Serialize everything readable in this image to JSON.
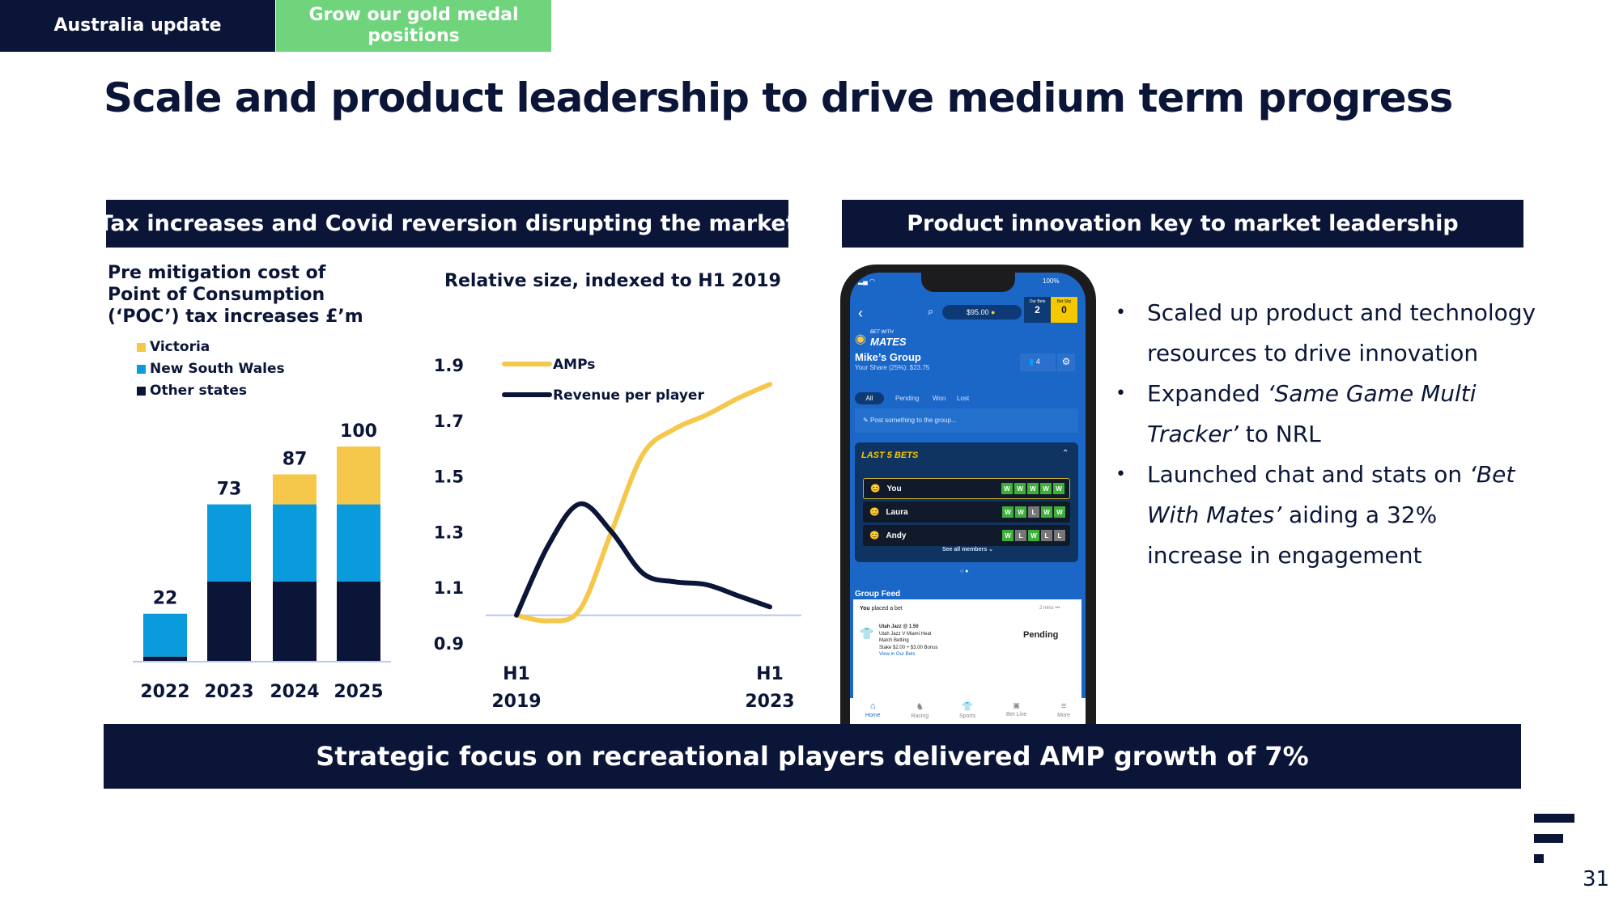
{
  "tags": {
    "section": "Australia update",
    "theme": "Grow our gold medal positions"
  },
  "title": "Scale and product leadership to drive medium term progress",
  "left_header": "Tax increases and Covid reversion disrupting the market",
  "right_header": "Product innovation key to market leadership",
  "banner": "Strategic focus on recreational players delivered AMP growth of 7%",
  "bullets": [
    {
      "pre": "Scaled up product and technology resources to drive innovation",
      "em": "",
      "post": ""
    },
    {
      "pre": "Expanded ",
      "em": "‘Same Game Multi Tracker’",
      "post": " to NRL"
    },
    {
      "pre": "Launched chat and stats on ",
      "em": "‘Bet With Mates’",
      "post": " aiding a 32% increase in engagement"
    }
  ],
  "page_number": "31",
  "colors": {
    "navy": "#0b1538",
    "green": "#6fd47c",
    "victoria": "#f5c84c",
    "nsw": "#0a9bdc",
    "other": "#0b1538",
    "baseline": "#b9c8ee"
  },
  "chart_data": [
    {
      "type": "bar",
      "stacked": true,
      "title": "Pre mitigation cost of Point of Consumption (‘POC’) tax increases £’m",
      "categories": [
        "2022",
        "2023",
        "2024",
        "2025"
      ],
      "series": [
        {
          "name": "Other states",
          "values": [
            2,
            37,
            37,
            37
          ],
          "color": "#0b1538"
        },
        {
          "name": "New South Wales",
          "values": [
            20,
            36,
            36,
            36
          ],
          "color": "#0a9bdc"
        },
        {
          "name": "Victoria",
          "values": [
            0,
            0,
            14,
            27
          ],
          "color": "#f5c84c"
        }
      ],
      "totals": [
        "22",
        "73",
        "87",
        "100"
      ],
      "legend_order": [
        "Victoria",
        "New South Wales",
        "Other states"
      ],
      "legend": "top-left",
      "ylim": [
        0,
        100
      ]
    },
    {
      "type": "line",
      "title": "Relative size, indexed to H1 2019",
      "x_tick_labels": [
        [
          "H1",
          "2019"
        ],
        [
          "H1",
          "2023"
        ]
      ],
      "x": [
        0,
        1,
        2,
        3,
        4,
        5,
        6,
        7,
        8
      ],
      "y_ticks": [
        "1.9",
        "1.7",
        "1.5",
        "1.3",
        "1.1",
        "0.9"
      ],
      "ylim": [
        0.9,
        1.9
      ],
      "reference_line": 1.0,
      "series": [
        {
          "name": "AMPs",
          "values": [
            1.0,
            0.98,
            1.02,
            1.3,
            1.58,
            1.67,
            1.72,
            1.78,
            1.83
          ],
          "color": "#f5c84c"
        },
        {
          "name": "Revenue per player",
          "values": [
            1.0,
            1.25,
            1.4,
            1.3,
            1.15,
            1.12,
            1.11,
            1.07,
            1.03
          ],
          "color": "#0b1538"
        }
      ],
      "legend": "top-left"
    }
  ],
  "phone": {
    "battery": "100%",
    "balance": "$95.00",
    "our_bets_label": "Our Bets",
    "our_bets": "2",
    "bet_slip_label": "Bet Slip",
    "bet_slip": "0",
    "logo_top": "BET WITH",
    "logo_main": "MATES",
    "group": "Mike’s Group",
    "share": "Your Share (25%): $23.75",
    "members": "4",
    "tabs": [
      "All",
      "Pending",
      "Won",
      "Lost"
    ],
    "post_placeholder": "Post something to the group...",
    "last5": "LAST 5 BETS",
    "rows": [
      {
        "name": "You",
        "res": [
          "W",
          "W",
          "W",
          "W",
          "W"
        ]
      },
      {
        "name": "Laura",
        "res": [
          "W",
          "W",
          "L",
          "W",
          "W"
        ]
      },
      {
        "name": "Andy",
        "res": [
          "W",
          "L",
          "W",
          "L",
          "L"
        ]
      }
    ],
    "see_all": "See all members ⌄",
    "feed": "Group Feed",
    "feed_who": "You",
    "feed_action": " placed a bet",
    "feed_time": "2 mins",
    "bet_title": "Utah Jazz @ 1.50",
    "bet_match": "Utah Jazz V Miami Heat",
    "bet_market": "Match Betting",
    "bet_stake": "Stake $2.00 + $3.00 Bonus",
    "bet_link": "View in Our Bets",
    "bet_status": "Pending",
    "nav": [
      "Home",
      "Racing",
      "Sports",
      "Bet Live",
      "More"
    ]
  }
}
